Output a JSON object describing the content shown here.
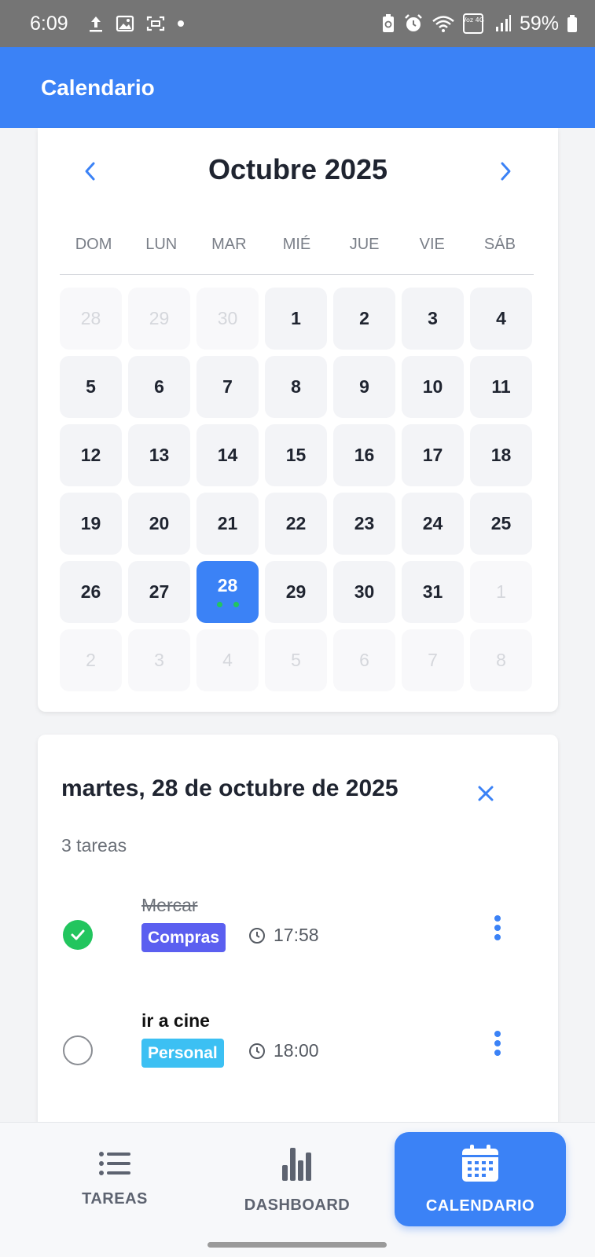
{
  "status_bar": {
    "time": "6:09",
    "battery": "59%",
    "network_label": "Voz 4G",
    "icons": [
      "upload-icon",
      "image-icon",
      "screen-record-icon",
      "dot-icon",
      "battery-saver-icon",
      "alarm-icon",
      "wifi-icon",
      "volte-icon",
      "signal-icon",
      "battery-icon"
    ]
  },
  "app_bar": {
    "title": "Calendario"
  },
  "calendar": {
    "month_title": "Octubre 2025",
    "weekdays": [
      "DOM",
      "LUN",
      "MAR",
      "MIÉ",
      "JUE",
      "VIE",
      "SÁB"
    ],
    "days": [
      {
        "label": "28",
        "muted": true
      },
      {
        "label": "29",
        "muted": true
      },
      {
        "label": "30",
        "muted": true
      },
      {
        "label": "1"
      },
      {
        "label": "2"
      },
      {
        "label": "3"
      },
      {
        "label": "4"
      },
      {
        "label": "5"
      },
      {
        "label": "6"
      },
      {
        "label": "7"
      },
      {
        "label": "8"
      },
      {
        "label": "9"
      },
      {
        "label": "10"
      },
      {
        "label": "11"
      },
      {
        "label": "12"
      },
      {
        "label": "13"
      },
      {
        "label": "14"
      },
      {
        "label": "15"
      },
      {
        "label": "16"
      },
      {
        "label": "17"
      },
      {
        "label": "18"
      },
      {
        "label": "19"
      },
      {
        "label": "20"
      },
      {
        "label": "21"
      },
      {
        "label": "22"
      },
      {
        "label": "23"
      },
      {
        "label": "24"
      },
      {
        "label": "25"
      },
      {
        "label": "26"
      },
      {
        "label": "27"
      },
      {
        "label": "28",
        "selected": true,
        "task_dots": 2
      },
      {
        "label": "29"
      },
      {
        "label": "30"
      },
      {
        "label": "31"
      },
      {
        "label": "1",
        "muted": true
      },
      {
        "label": "2",
        "muted": true
      },
      {
        "label": "3",
        "muted": true
      },
      {
        "label": "4",
        "muted": true
      },
      {
        "label": "5",
        "muted": true
      },
      {
        "label": "6",
        "muted": true
      },
      {
        "label": "7",
        "muted": true
      },
      {
        "label": "8",
        "muted": true
      }
    ]
  },
  "day_detail": {
    "title": "martes, 28 de octubre de 2025",
    "task_count": "3 tareas",
    "tasks": [
      {
        "name": "Mercar",
        "done": true,
        "tag": "Compras",
        "tag_color": "#5b5ff0",
        "time": "17:58"
      },
      {
        "name": "ir a cine",
        "done": false,
        "tag": "Personal",
        "tag_color": "#3cc0f3",
        "time": "18:00"
      }
    ]
  },
  "bottom_nav": {
    "items": [
      {
        "label": "TAREAS",
        "icon": "list-icon",
        "active": false
      },
      {
        "label": "DASHBOARD",
        "icon": "bar-chart-icon",
        "active": false
      },
      {
        "label": "CALENDARIO",
        "icon": "calendar-icon",
        "active": true
      }
    ]
  },
  "colors": {
    "accent": "#3b82f6",
    "done_green": "#22c55e",
    "status_bar": "#757575"
  }
}
